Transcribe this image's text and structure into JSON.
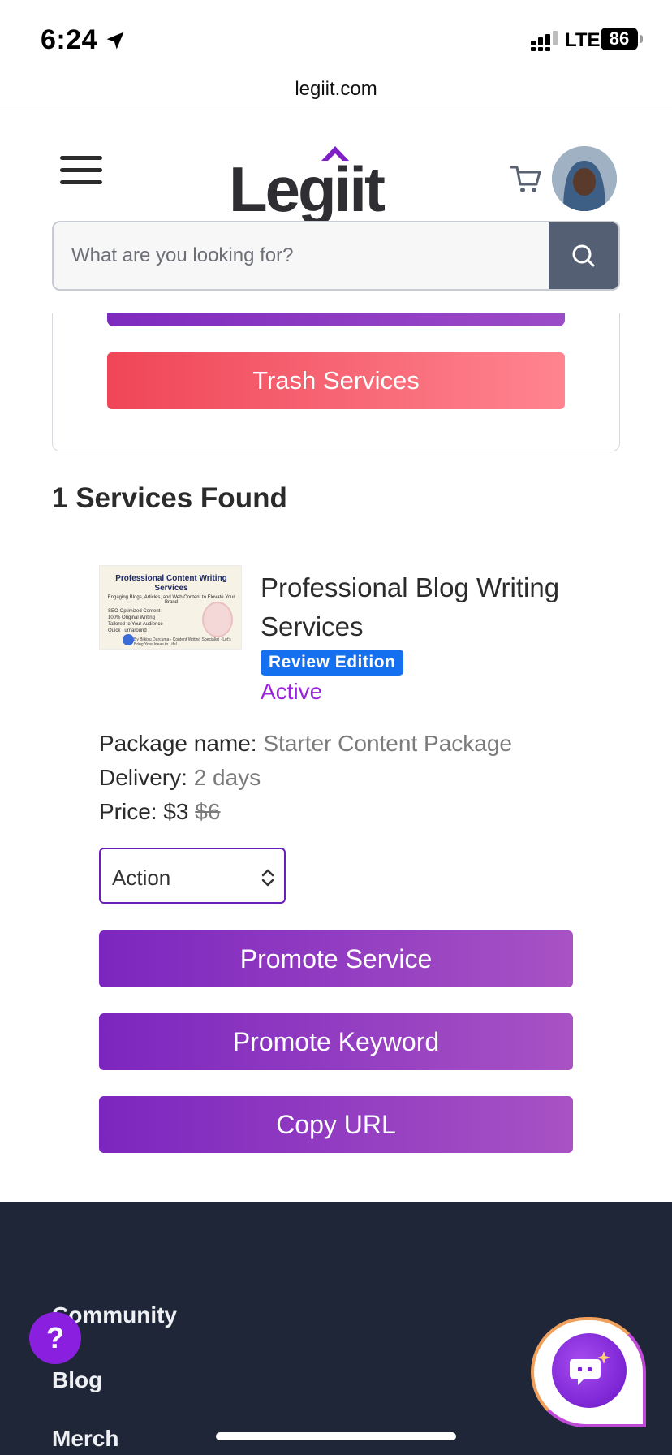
{
  "status_bar": {
    "time": "6:24",
    "network": "LTE",
    "battery": "86"
  },
  "browser": {
    "url": "legiit.com"
  },
  "header": {
    "logo_text": "Legiit",
    "search_placeholder": "What are you looking for?"
  },
  "filters": {
    "trash_label": "Trash Services"
  },
  "results": {
    "heading": "1 Services Found"
  },
  "service": {
    "thumbnail": {
      "title": "Professional Content Writing Services",
      "subtitle": "Engaging Blogs, Articles, and Web Content to Elevate Your Brand",
      "bullets": [
        "SEO-Optimized Content",
        "100% Original Writing",
        "Tailored to Your Audience",
        "Quick Turnaround"
      ],
      "footer": "By Bilkisu Darcuma - Content Writing Specialist · Let's Bring Your Ideas to Life!"
    },
    "title": "Professional Blog Writing Services",
    "badge": "Review Edition",
    "status": "Active",
    "package_label": "Package name:",
    "package_value": "Starter Content Package",
    "delivery_label": "Delivery:",
    "delivery_value": "2 days",
    "price_label": "Price:",
    "price_value": "$3",
    "price_original": "$6",
    "action_select": "Action",
    "buttons": {
      "promote_service": "Promote Service",
      "promote_keyword": "Promote Keyword",
      "copy_url": "Copy URL"
    }
  },
  "footer": {
    "links": [
      "Community",
      "Blog",
      "Merch"
    ]
  },
  "floating": {
    "help": "?"
  },
  "colors": {
    "brand_purple": "#7c26bf",
    "trash_red": "#ef4657",
    "badge_blue": "#1570ef",
    "status_purple": "#9b22e0",
    "footer_bg": "#1f2637"
  }
}
